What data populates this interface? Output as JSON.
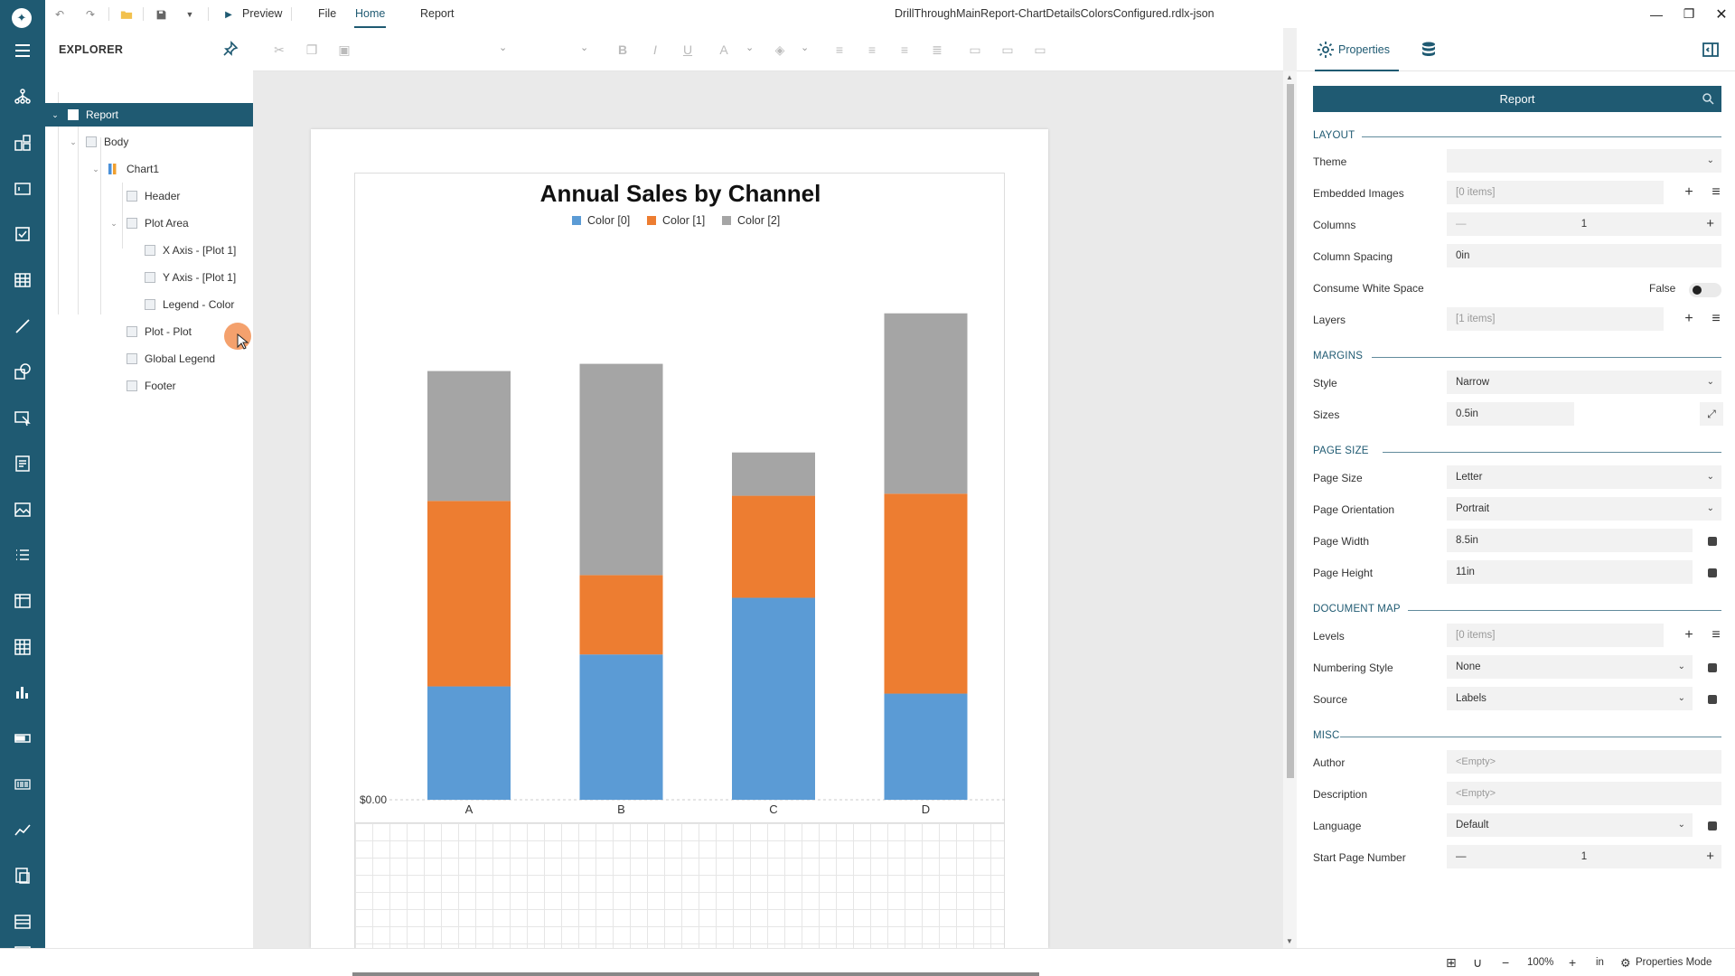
{
  "topbar": {
    "preview_label": "Preview",
    "menu_file": "File",
    "menu_home": "Home",
    "menu_report": "Report",
    "document_title": "DrillThroughMainReport-ChartDetailsColorsConfigured.rdlx-json"
  },
  "explorer": {
    "title": "EXPLORER",
    "tree": [
      {
        "label": "Report",
        "level": 0,
        "selected": true,
        "expanded": true
      },
      {
        "label": "Body",
        "level": 1,
        "expanded": true
      },
      {
        "label": "Chart1",
        "level": 2,
        "expanded": true
      },
      {
        "label": "Header",
        "level": 3
      },
      {
        "label": "Plot Area",
        "level": 3,
        "expanded": true
      },
      {
        "label": "X Axis - [Plot 1]",
        "level": 4
      },
      {
        "label": "Y Axis - [Plot 1]",
        "level": 4
      },
      {
        "label": "Legend - Color",
        "level": 4
      },
      {
        "label": "Plot - Plot",
        "level": 3
      },
      {
        "label": "Global Legend",
        "level": 3
      },
      {
        "label": "Footer",
        "level": 3
      }
    ]
  },
  "chart_data": {
    "type": "bar",
    "stacked": true,
    "title": "Annual Sales by Channel",
    "categories": [
      "A",
      "B",
      "C",
      "D"
    ],
    "series": [
      {
        "name": "Color [0]",
        "color": "#5b9bd5",
        "values": [
          110,
          141,
          196,
          103
        ]
      },
      {
        "name": "Color [1]",
        "color": "#ed7d31",
        "values": [
          180,
          77,
          99,
          194
        ]
      },
      {
        "name": "Color [2]",
        "color": "#a5a5a5",
        "values": [
          126,
          205,
          42,
          175
        ]
      }
    ],
    "y_tick_label": "$0.00",
    "ylim": [
      0,
      470
    ],
    "legend_position": "top"
  },
  "properties": {
    "tab_label": "Properties",
    "object_name": "Report",
    "sections": {
      "layout": "LAYOUT",
      "margins": "MARGINS",
      "page_size": "PAGE SIZE",
      "document_map": "DOCUMENT MAP",
      "misc": "MISC"
    },
    "theme_label": "Theme",
    "theme_value": "",
    "embedded_images_label": "Embedded Images",
    "embedded_images_value": "[0 items]",
    "columns_label": "Columns",
    "columns_value": "1",
    "column_spacing_label": "Column Spacing",
    "column_spacing_value": "0in",
    "consume_ws_label": "Consume White Space",
    "consume_ws_value": "False",
    "layers_label": "Layers",
    "layers_value": "[1 items]",
    "style_label": "Style",
    "style_value": "Narrow",
    "sizes_label": "Sizes",
    "sizes_value": "0.5in",
    "page_size_label": "Page Size",
    "page_size_value": "Letter",
    "page_orientation_label": "Page Orientation",
    "page_orientation_value": "Portrait",
    "page_width_label": "Page Width",
    "page_width_value": "8.5in",
    "page_height_label": "Page Height",
    "page_height_value": "11in",
    "levels_label": "Levels",
    "levels_value": "[0 items]",
    "numbering_style_label": "Numbering Style",
    "numbering_style_value": "None",
    "source_label": "Source",
    "source_value": "Labels",
    "author_label": "Author",
    "author_placeholder": "<Empty>",
    "description_label": "Description",
    "description_placeholder": "<Empty>",
    "language_label": "Language",
    "language_value": "Default",
    "start_page_label": "Start Page Number",
    "start_page_value": "1"
  },
  "status": {
    "zoom": "100%",
    "unit": "in",
    "mode_label": "Properties Mode"
  },
  "colors": {
    "accent": "#1f5a72"
  }
}
